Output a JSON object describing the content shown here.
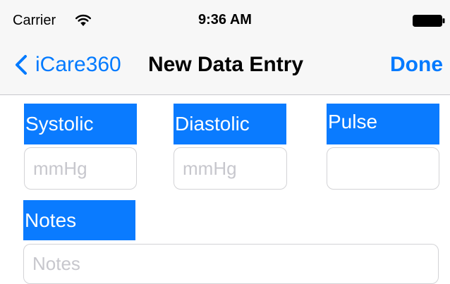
{
  "status_bar": {
    "carrier": "Carrier",
    "time": "9:36 AM"
  },
  "nav_bar": {
    "back_label": "iCare360",
    "title": "New Data Entry",
    "done_label": "Done"
  },
  "form": {
    "systolic": {
      "label": "Systolic",
      "placeholder": "mmHg",
      "value": ""
    },
    "diastolic": {
      "label": "Diastolic",
      "placeholder": "mmHg",
      "value": ""
    },
    "pulse": {
      "label": "Pulse",
      "placeholder": "",
      "value": ""
    },
    "notes": {
      "label": "Notes",
      "placeholder": "Notes",
      "value": ""
    }
  },
  "colors": {
    "accent": "#007aff",
    "label_background": "#0a7bff",
    "placeholder_text": "#c7c7cd",
    "bar_background": "#f7f7f7"
  },
  "icons": {
    "wifi": "wifi-icon",
    "battery": "battery-icon",
    "back": "chevron-left-icon"
  }
}
